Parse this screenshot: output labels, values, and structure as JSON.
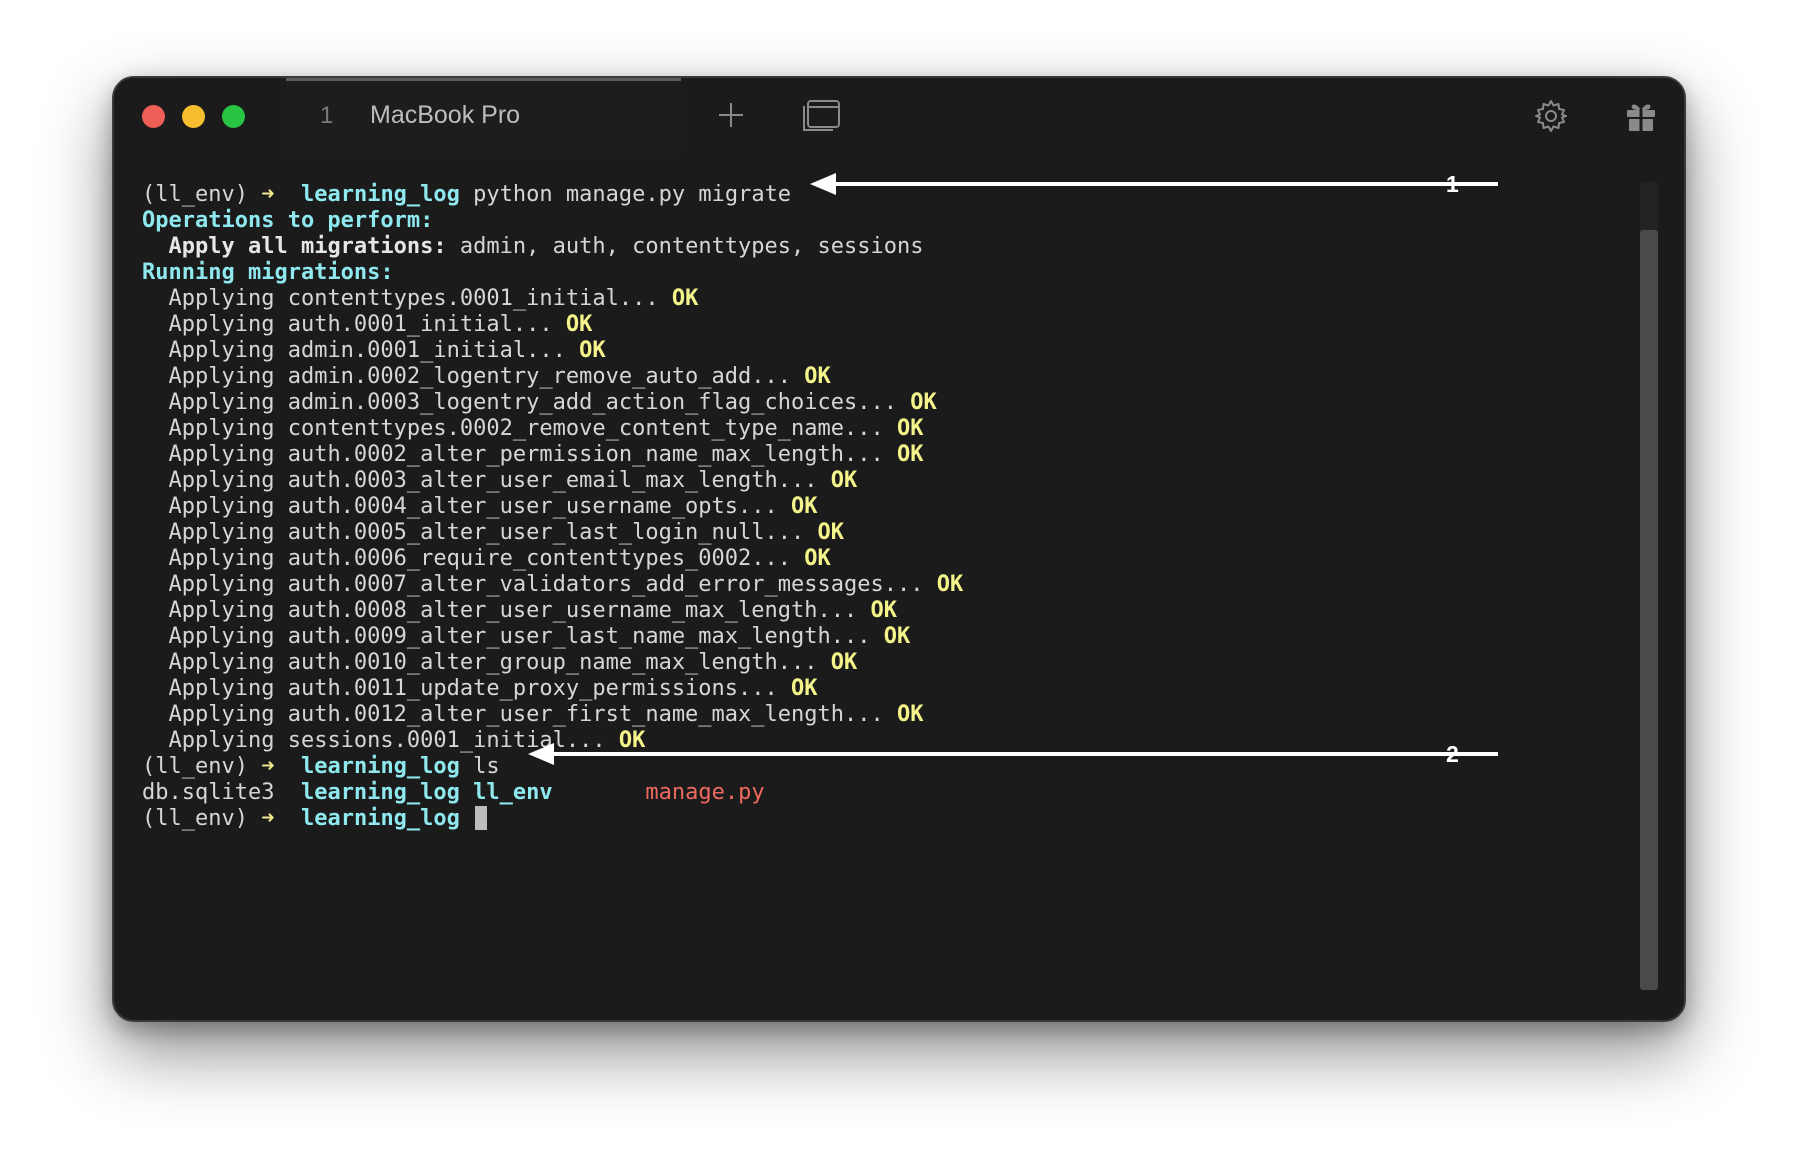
{
  "window": {
    "tab_number": "1",
    "tab_title": "MacBook Pro",
    "icons": [
      "close-button",
      "minimize-button",
      "zoom-button",
      "new-tab-plus-icon",
      "window-overview-icon",
      "gear-icon",
      "gift-icon"
    ]
  },
  "terminal": {
    "line1": {
      "env": "(ll_env)",
      "arrow": "➜",
      "dir": "learning_log",
      "cmd": "python manage.py migrate"
    },
    "line2": "Operations to perform:",
    "line3": {
      "label": "Apply all migrations:",
      "value": "admin, auth, contenttypes, sessions"
    },
    "line4": "Running migrations:",
    "migrations": [
      {
        "text": "Applying contenttypes.0001_initial...",
        "status": "OK"
      },
      {
        "text": "Applying auth.0001_initial...",
        "status": "OK"
      },
      {
        "text": "Applying admin.0001_initial...",
        "status": "OK"
      },
      {
        "text": "Applying admin.0002_logentry_remove_auto_add...",
        "status": "OK"
      },
      {
        "text": "Applying admin.0003_logentry_add_action_flag_choices...",
        "status": "OK"
      },
      {
        "text": "Applying contenttypes.0002_remove_content_type_name...",
        "status": "OK"
      },
      {
        "text": "Applying auth.0002_alter_permission_name_max_length...",
        "status": "OK"
      },
      {
        "text": "Applying auth.0003_alter_user_email_max_length...",
        "status": "OK"
      },
      {
        "text": "Applying auth.0004_alter_user_username_opts...",
        "status": "OK"
      },
      {
        "text": "Applying auth.0005_alter_user_last_login_null...",
        "status": "OK"
      },
      {
        "text": "Applying auth.0006_require_contenttypes_0002...",
        "status": "OK"
      },
      {
        "text": "Applying auth.0007_alter_validators_add_error_messages...",
        "status": "OK"
      },
      {
        "text": "Applying auth.0008_alter_user_username_max_length...",
        "status": "OK"
      },
      {
        "text": "Applying auth.0009_alter_user_last_name_max_length...",
        "status": "OK"
      },
      {
        "text": "Applying auth.0010_alter_group_name_max_length...",
        "status": "OK"
      },
      {
        "text": "Applying auth.0011_update_proxy_permissions...",
        "status": "OK"
      },
      {
        "text": "Applying auth.0012_alter_user_first_name_max_length...",
        "status": "OK"
      },
      {
        "text": "Applying sessions.0001_initial...",
        "status": "OK"
      }
    ],
    "line_ls": {
      "env": "(ll_env)",
      "arrow": "➜",
      "dir": "learning_log",
      "cmd": "ls"
    },
    "ls_output": {
      "file1": "db.sqlite3",
      "dir1": "learning_log",
      "dir2": "ll_env",
      "file2": "manage.py"
    },
    "line_last": {
      "env": "(ll_env)",
      "arrow": "➜",
      "dir": "learning_log"
    }
  },
  "annotations": {
    "one": "1",
    "two": "2"
  },
  "colors": {
    "background": "#1b1b1b",
    "directory": "#8ee8ee",
    "ok": "#f4f48a",
    "python_file": "#ef6a5e",
    "prompt_arrow": "#f0e68c"
  }
}
